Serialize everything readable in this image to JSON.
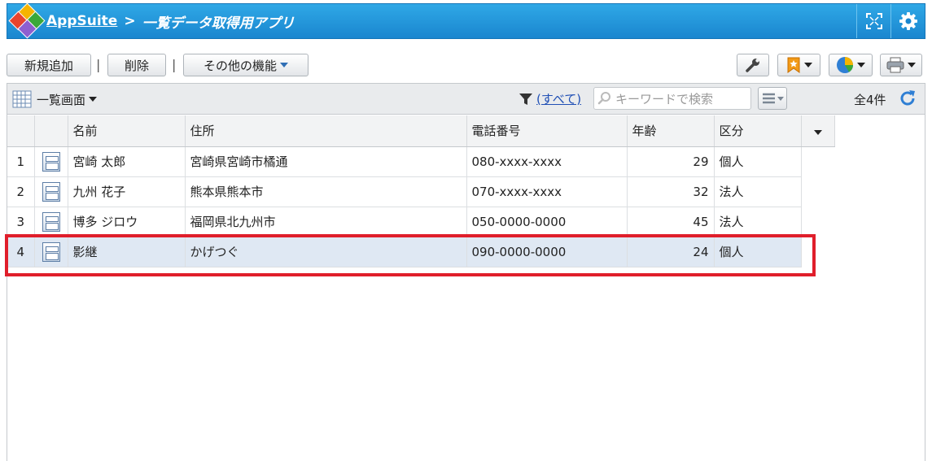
{
  "header": {
    "app_name": "AppSuite",
    "separator": ">",
    "page_title": "一覧データ取得用アプリ",
    "brand_color": "#1a86cf"
  },
  "toolbar": {
    "new_label": "新規追加",
    "delete_label": "削除",
    "more_label": "その他の機能",
    "pipe": "|"
  },
  "list_bar": {
    "view_label": "一覧画面",
    "filter_label": "(すべて)",
    "search_placeholder": "キーワードで検索",
    "count_label": "全4件"
  },
  "table": {
    "columns": [
      "名前",
      "住所",
      "電話番号",
      "年齢",
      "区分"
    ],
    "rows": [
      {
        "no": "1",
        "name": "宮崎 太郎",
        "address": "宮崎県宮崎市橘通",
        "phone": "080-xxxx-xxxx",
        "age": "29",
        "type": "個人"
      },
      {
        "no": "2",
        "name": "九州 花子",
        "address": "熊本県熊本市",
        "phone": "070-xxxx-xxxx",
        "age": "32",
        "type": "法人"
      },
      {
        "no": "3",
        "name": "博多 ジロウ",
        "address": "福岡県北九州市",
        "phone": "050-0000-0000",
        "age": "45",
        "type": "法人"
      },
      {
        "no": "4",
        "name": "影継",
        "address": "かげつぐ",
        "phone": "090-0000-0000",
        "age": "24",
        "type": "個人"
      }
    ],
    "highlight_color": "#e01e2b"
  }
}
